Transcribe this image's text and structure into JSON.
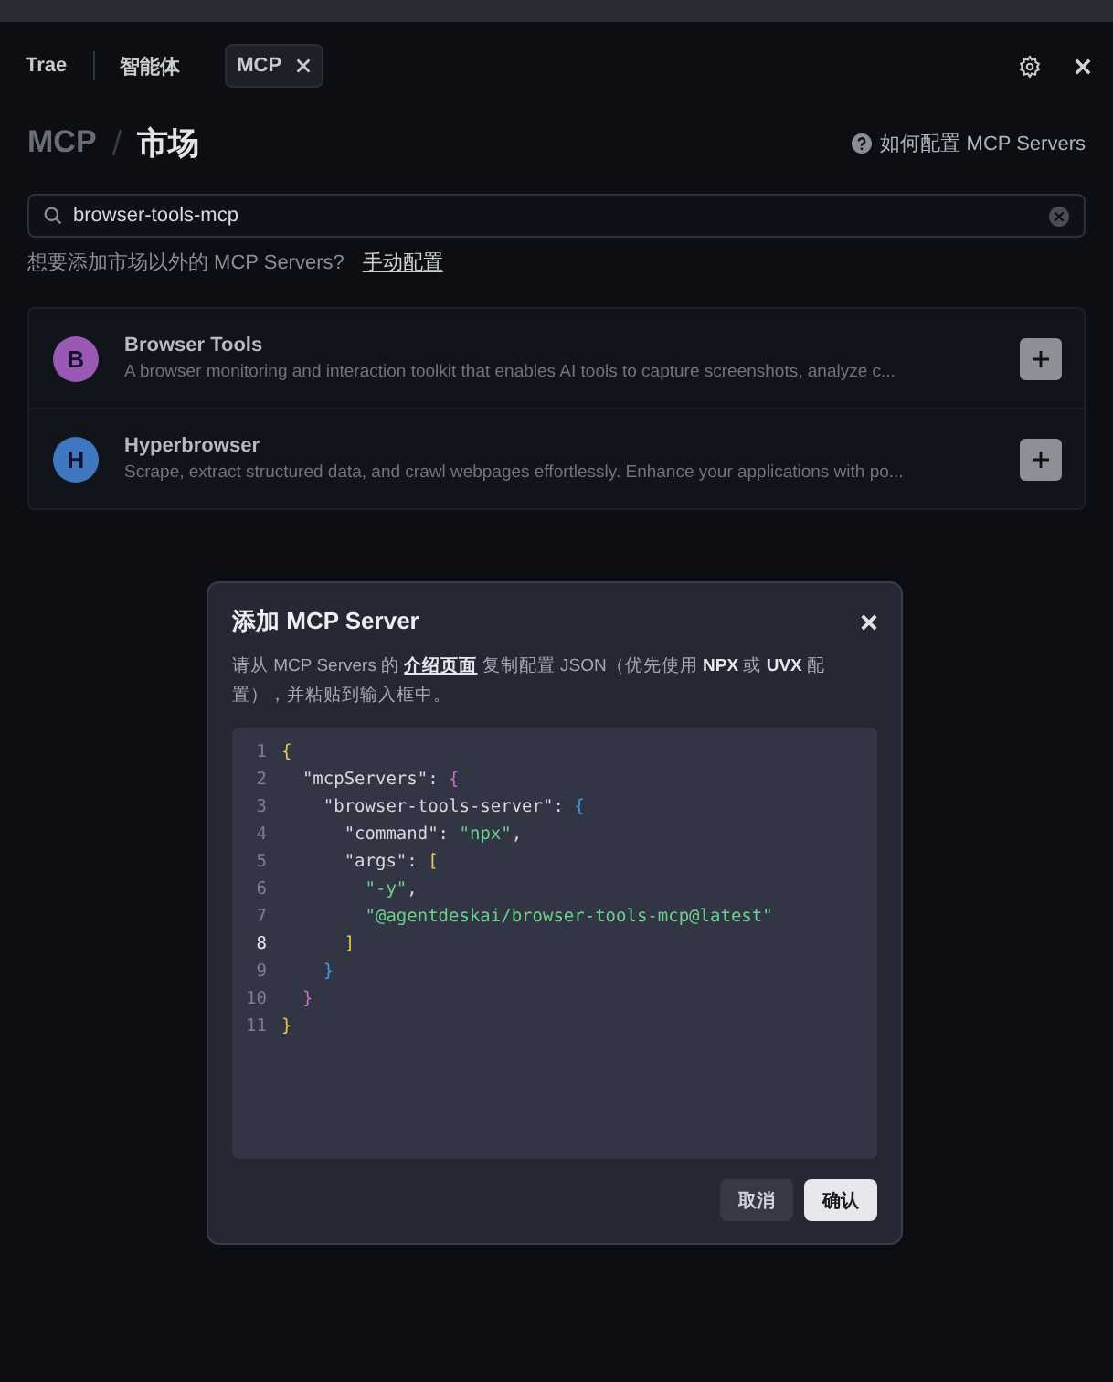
{
  "tabs": [
    {
      "label": "Trae",
      "selected": false,
      "closable": false
    },
    {
      "label": "智能体",
      "selected": false,
      "closable": false
    },
    {
      "label": "MCP",
      "selected": true,
      "closable": true
    }
  ],
  "header": {
    "breadcrumb": [
      "MCP",
      "市场"
    ],
    "help_link": "如何配置 MCP Servers"
  },
  "search": {
    "value": "browser-tools-mcp"
  },
  "hint": {
    "text": "想要添加市场以外的 MCP Servers?",
    "link": "手动配置"
  },
  "servers": [
    {
      "initial": "B",
      "color": "#9b59b6",
      "name": "Browser Tools",
      "description": "A browser monitoring and interaction toolkit that enables AI tools to capture screenshots, analyze c..."
    },
    {
      "initial": "H",
      "color": "#3f78c0",
      "name": "Hyperbrowser",
      "description": "Scrape, extract structured data, and crawl webpages effortlessly. Enhance your applications with po..."
    }
  ],
  "dialog": {
    "title": "添加 MCP Server",
    "description": "请从 MCP Servers 的 **介绍页面** 复制配置 JSON（优先使用 **NPX** 或 **UVX** 配置），并粘贴到输入框中。",
    "code": [
      {
        "number": "1",
        "current": false,
        "tokens": [
          {
            "kind": "b1",
            "text": "{"
          }
        ]
      },
      {
        "number": "2",
        "current": false,
        "tokens": [
          {
            "kind": "key",
            "text": "  \"mcpServers\""
          },
          {
            "kind": "p",
            "text": ": "
          },
          {
            "kind": "b2",
            "text": "{"
          }
        ]
      },
      {
        "number": "3",
        "current": false,
        "tokens": [
          {
            "kind": "key",
            "text": "    \"browser-tools-server\""
          },
          {
            "kind": "p",
            "text": ": "
          },
          {
            "kind": "b3",
            "text": "{"
          }
        ]
      },
      {
        "number": "4",
        "current": false,
        "tokens": [
          {
            "kind": "key",
            "text": "      \"command\""
          },
          {
            "kind": "p",
            "text": ": "
          },
          {
            "kind": "str",
            "text": "\"npx\""
          },
          {
            "kind": "p",
            "text": ","
          }
        ]
      },
      {
        "number": "5",
        "current": false,
        "tokens": [
          {
            "kind": "key",
            "text": "      \"args\""
          },
          {
            "kind": "p",
            "text": ": "
          },
          {
            "kind": "b1",
            "text": "["
          }
        ]
      },
      {
        "number": "6",
        "current": false,
        "tokens": [
          {
            "kind": "str",
            "text": "        \"-y\""
          },
          {
            "kind": "p",
            "text": ","
          }
        ]
      },
      {
        "number": "7",
        "current": false,
        "tokens": [
          {
            "kind": "str",
            "text": "        \"@agentdeskai/browser-tools-mcp@latest\""
          }
        ]
      },
      {
        "number": "8",
        "current": true,
        "tokens": [
          {
            "kind": "b1",
            "text": "      ]"
          }
        ]
      },
      {
        "number": "9",
        "current": false,
        "tokens": [
          {
            "kind": "b3",
            "text": "    }"
          }
        ]
      },
      {
        "number": "10",
        "current": false,
        "tokens": [
          {
            "kind": "b2",
            "text": "  }"
          }
        ]
      },
      {
        "number": "11",
        "current": false,
        "tokens": [
          {
            "kind": "b1",
            "text": "}"
          }
        ]
      }
    ],
    "buttons": [
      {
        "label": "取消",
        "kind": "secondary"
      },
      {
        "label": "确认",
        "kind": "primary"
      }
    ]
  }
}
